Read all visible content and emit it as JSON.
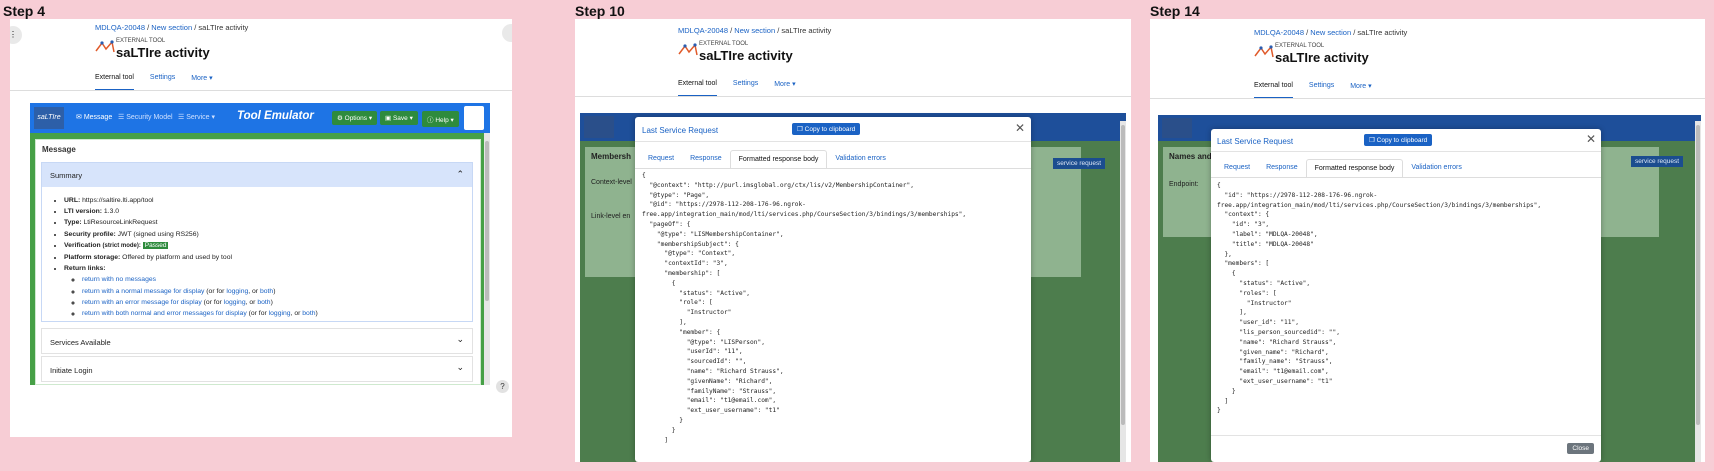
{
  "steps": [
    {
      "label": "Step 4",
      "breadcrumb": {
        "course": "MDLQA-20048",
        "section": "New section",
        "activity": "saLTIre activity"
      },
      "external_tool_label": "EXTERNAL TOOL",
      "activity_title": "saLTIre activity",
      "tabs": [
        "External tool",
        "Settings",
        "More ▾"
      ],
      "emulator": {
        "nav": {
          "message": "Message",
          "security_model": "Security Model",
          "service": "Service ▾"
        },
        "title": "Tool Emulator",
        "buttons": {
          "options": "Options",
          "save": "Save",
          "help": "Help"
        },
        "card_title": "Message",
        "summary": {
          "title": "Summary",
          "url_label": "URL:",
          "url": "https://saltire.lti.app/tool",
          "lti_version_label": "LTI version:",
          "lti_version": "1.3.0",
          "type_label": "Type:",
          "type": "LtiResourceLinkRequest",
          "security_label": "Security profile:",
          "security": "JWT (signed using RS256)",
          "verification_label": "Verification",
          "verification_mode": "(strict mode):",
          "verification": "Passed",
          "storage_label": "Platform storage:",
          "storage": "Offered by platform and used by tool",
          "return_links_label": "Return links:",
          "return_links": {
            "no_messages": "return with no messages",
            "normal_prefix": "return with a normal message for display",
            "error_prefix": "return with an error message for display",
            "both_prefix": "return with both normal and error messages for display",
            "or_for": "(or for",
            "logging": "logging",
            "or": ", or",
            "both": "both",
            "close": ")"
          }
        },
        "services_available": "Services Available",
        "initiate_login": "Initiate Login"
      },
      "help_icon": "?"
    },
    {
      "label": "Step 10",
      "breadcrumb": {
        "course": "MDLQA-20048",
        "section": "New section",
        "activity": "saLTIre activity"
      },
      "external_tool_label": "EXTERNAL TOOL",
      "activity_title": "saLTIre activity",
      "tabs": [
        "External tool",
        "Settings",
        "More ▾"
      ],
      "behind": {
        "membersh": "Membersh",
        "context_level": "Context-level",
        "link_level": "Link-level en",
        "service_request": "service request"
      },
      "modal": {
        "title": "Last Service Request",
        "copy": "Copy to clipboard",
        "tabs": [
          "Request",
          "Response",
          "Formatted response body",
          "Validation errors"
        ],
        "body": "{\n  \"@context\": \"http://purl.imsglobal.org/ctx/lis/v2/MembershipContainer\",\n  \"@type\": \"Page\",\n  \"@id\": \"https://2978-112-208-176-96.ngrok-\nfree.app/integration_main/mod/lti/services.php/CourseSection/3/bindings/3/memberships\",\n  \"pageOf\": {\n    \"@type\": \"LISMembershipContainer\",\n    \"membershipSubject\": {\n      \"@type\": \"Context\",\n      \"contextId\": \"3\",\n      \"membership\": [\n        {\n          \"status\": \"Active\",\n          \"role\": [\n            \"Instructor\"\n          ],\n          \"member\": {\n            \"@type\": \"LISPerson\",\n            \"userId\": \"11\",\n            \"sourcedId\": \"\",\n            \"name\": \"Richard Strauss\",\n            \"givenName\": \"Richard\",\n            \"familyName\": \"Strauss\",\n            \"email\": \"t1@email.com\",\n            \"ext_user_username\": \"t1\"\n          }\n        }\n      ]"
      }
    },
    {
      "label": "Step 14",
      "breadcrumb": {
        "course": "MDLQA-20048",
        "section": "New section",
        "activity": "saLTIre activity"
      },
      "external_tool_label": "EXTERNAL TOOL",
      "activity_title": "saLTIre activity",
      "tabs": [
        "External tool",
        "Settings",
        "More ▾"
      ],
      "behind": {
        "names_and": "Names and",
        "endpoint": "Endpoint:",
        "service_request": "service request"
      },
      "modal": {
        "title": "Last Service Request",
        "copy": "Copy to clipboard",
        "tabs": [
          "Request",
          "Response",
          "Formatted response body",
          "Validation errors"
        ],
        "body": "{\n  \"id\": \"https://2978-112-208-176-96.ngrok-\nfree.app/integration_main/mod/lti/services.php/CourseSection/3/bindings/3/memberships\",\n  \"context\": {\n    \"id\": \"3\",\n    \"label\": \"MDLQA-20048\",\n    \"title\": \"MDLQA-20048\"\n  },\n  \"members\": [\n    {\n      \"status\": \"Active\",\n      \"roles\": [\n        \"Instructor\"\n      ],\n      \"user_id\": \"11\",\n      \"lis_person_sourcedid\": \"\",\n      \"name\": \"Richard Strauss\",\n      \"given_name\": \"Richard\",\n      \"family_name\": \"Strauss\",\n      \"email\": \"t1@email.com\",\n      \"ext_user_username\": \"t1\"\n    }\n  ]\n}",
        "close": "Close"
      }
    }
  ]
}
